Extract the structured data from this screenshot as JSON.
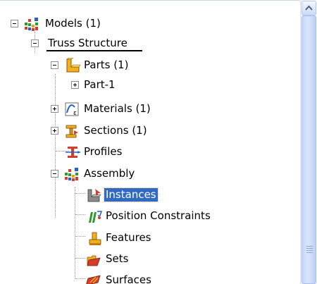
{
  "tree": {
    "models": "Models (1)",
    "truss": "Truss Structure",
    "parts": "Parts (1)",
    "part1": "Part-1",
    "materials": "Materials (1)",
    "sections": "Sections (1)",
    "profiles": "Profiles",
    "assembly": "Assembly",
    "instances": "Instances",
    "position_constraints": "Position Constraints",
    "features": "Features",
    "sets": "Sets",
    "surfaces": "Surfaces"
  },
  "icons": {
    "models": "models-tree-icon",
    "parts": "parts-icon",
    "materials": "materials-icon",
    "sections": "sections-icon",
    "profiles": "profiles-icon",
    "assembly": "assembly-icon",
    "instances": "instances-icon",
    "position_constraints": "position-constraints-icon",
    "features": "features-icon",
    "sets": "sets-icon",
    "surfaces": "surfaces-icon"
  },
  "colors": {
    "selection": "#316ac5",
    "scrollbar": "#c6d6f7"
  }
}
